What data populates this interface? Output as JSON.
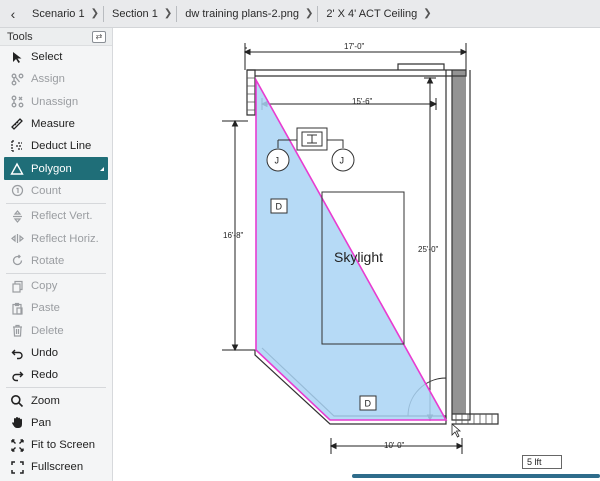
{
  "breadcrumb": {
    "items": [
      "Scenario 1",
      "Section 1",
      "dw training plans-2.png",
      "2' X 4' ACT Ceiling"
    ]
  },
  "tools": {
    "title": "Tools",
    "items": [
      {
        "label": "Select",
        "icon": "cursor-icon",
        "state": "enabled"
      },
      {
        "label": "Assign",
        "icon": "assign-icon",
        "state": "disabled"
      },
      {
        "label": "Unassign",
        "icon": "unassign-icon",
        "state": "disabled"
      },
      {
        "label": "Measure",
        "icon": "ruler-icon",
        "state": "enabled"
      },
      {
        "label": "Deduct Line",
        "icon": "deduct-line-icon",
        "state": "enabled"
      },
      {
        "label": "Polygon",
        "icon": "triangle-icon",
        "state": "active"
      },
      {
        "label": "Count",
        "icon": "count-icon",
        "state": "disabled"
      },
      {
        "label": "Reflect Vert.",
        "icon": "reflect-vertical-icon",
        "state": "disabled"
      },
      {
        "label": "Reflect Horiz.",
        "icon": "reflect-horizontal-icon",
        "state": "disabled"
      },
      {
        "label": "Rotate",
        "icon": "rotate-icon",
        "state": "disabled"
      },
      {
        "label": "Copy",
        "icon": "copy-icon",
        "state": "disabled"
      },
      {
        "label": "Paste",
        "icon": "paste-icon",
        "state": "disabled"
      },
      {
        "label": "Delete",
        "icon": "trash-icon",
        "state": "disabled"
      },
      {
        "label": "Undo",
        "icon": "undo-icon",
        "state": "enabled"
      },
      {
        "label": "Redo",
        "icon": "redo-icon",
        "state": "enabled"
      },
      {
        "label": "Zoom",
        "icon": "zoom-icon",
        "state": "enabled"
      },
      {
        "label": "Pan",
        "icon": "hand-icon",
        "state": "enabled"
      },
      {
        "label": "Fit to Screen",
        "icon": "fit-screen-icon",
        "state": "enabled"
      },
      {
        "label": "Fullscreen",
        "icon": "fullscreen-icon",
        "state": "enabled"
      }
    ]
  },
  "plan": {
    "dim_top": "17'-0\"",
    "dim_inner": "15'-6\"",
    "dim_left": "16'-8\"",
    "dim_right": "25'-0\"",
    "dim_bottom": "10'-0\"",
    "skylight": "Skylight",
    "tag_d": "D",
    "tag_j": "J",
    "scale": "5 lft"
  },
  "colors": {
    "accent": "#1f6e78",
    "polygon_fill": "#a9d3f5",
    "polygon_stroke": "#e83cd0",
    "scrollbar": "#2e6c8b"
  }
}
